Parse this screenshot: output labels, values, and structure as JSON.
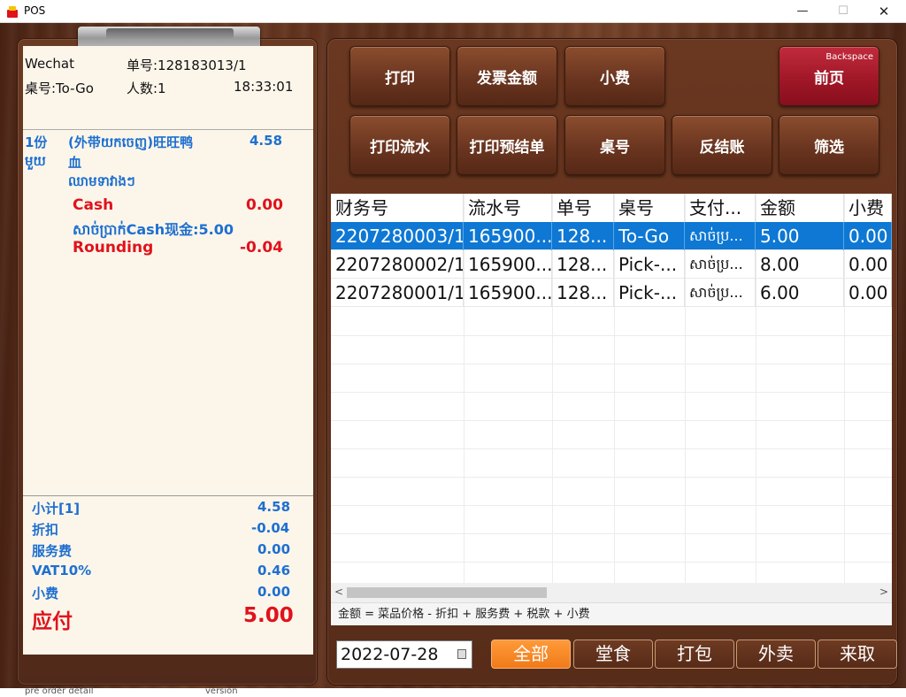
{
  "window": {
    "title": "POS",
    "min": "—",
    "max": "☐",
    "close": "✕"
  },
  "receipt": {
    "channel": "Wechat",
    "order_no": "单号:128183013/1",
    "table": "桌号:To-Go",
    "guests": "人数:1",
    "time": "18:33:01",
    "item": {
      "qty": "1份",
      "qty_km": "មួយ",
      "name_line1": "(外带យកចេញ)旺旺鸭",
      "name_line2": "血",
      "name_km": "ឈាមទាវាងៗ",
      "price": "4.58"
    },
    "payment": {
      "cash_label": "Cash",
      "cash_value": "0.00",
      "cash_note": "សាច់ប្រាក់Cash现金:5.00",
      "rounding_label": "Rounding",
      "rounding_value": "-0.04"
    },
    "totals": [
      {
        "label": "小计[1]",
        "value": "4.58"
      },
      {
        "label": "折扣",
        "value": "-0.04"
      },
      {
        "label": "服务费",
        "value": "0.00"
      },
      {
        "label": "VAT10%",
        "value": "0.46"
      },
      {
        "label": "小费",
        "value": "0.00"
      }
    ],
    "due_label": "应付",
    "due_value": "5.00"
  },
  "buttons": {
    "print": "打印",
    "invoice_amount": "发票金额",
    "tip": "小费",
    "home": "前页",
    "home_hint": "Backspace",
    "print_flow": "打印流水",
    "print_prebill": "打印预结单",
    "table_no": "桌号",
    "unsettle": "反结账",
    "filter": "筛选"
  },
  "grid": {
    "columns": [
      "财务号",
      "流水号",
      "单号",
      "桌号",
      "支付...",
      "金额",
      "小费"
    ],
    "rows": [
      [
        "2207280003/1",
        "165900...",
        "128...",
        "To-Go",
        "សាច់ប្រ...",
        "5.00",
        "0.00"
      ],
      [
        "2207280002/1",
        "165900...",
        "128...",
        "Pick-...",
        "សាច់ប្រ...",
        "8.00",
        "0.00"
      ],
      [
        "2207280001/1",
        "165900...",
        "128...",
        "Pick-...",
        "សាច់ប្រ...",
        "6.00",
        "0.00"
      ]
    ],
    "selected_row": 0,
    "formula": "金额 = 菜品价格 - 折扣 + 服务费 + 税款 + 小费"
  },
  "filter_bar": {
    "date": "2022-07-28",
    "tabs": [
      "全部",
      "堂食",
      "打包",
      "外卖",
      "来取"
    ],
    "active_tab": 0
  },
  "bottom": {
    "left": "pre order detail",
    "right": "version"
  },
  "colors": {
    "accent_orange": "#f58a24",
    "selected_row": "#0e78d4",
    "amount_blue": "#1e6fd0",
    "amount_red": "#e0121c"
  }
}
